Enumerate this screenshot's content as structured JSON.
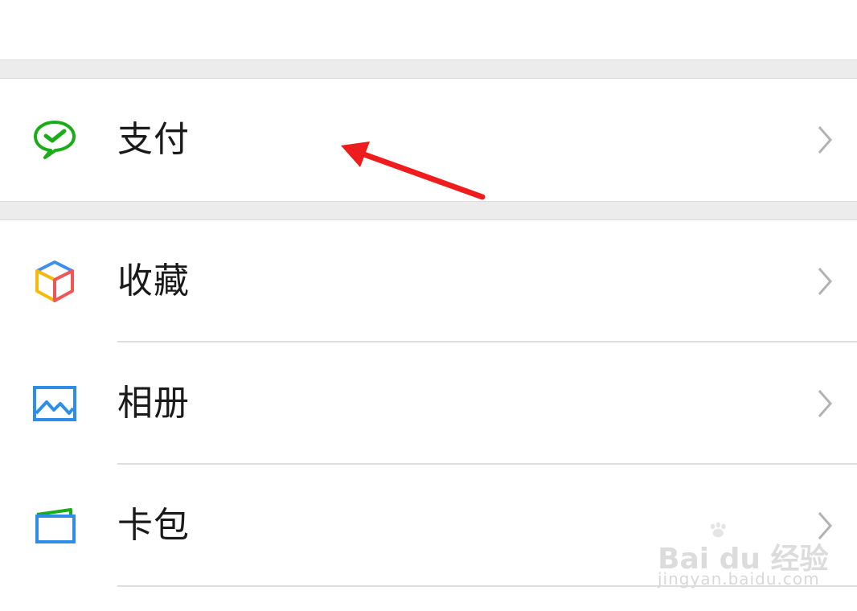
{
  "menu": {
    "items": [
      {
        "label": "支付",
        "icon": "wechat-pay-icon"
      },
      {
        "label": "收藏",
        "icon": "favorites-cube-icon"
      },
      {
        "label": "相册",
        "icon": "album-picture-icon"
      },
      {
        "label": "卡包",
        "icon": "card-wallet-icon"
      }
    ]
  },
  "annotation": {
    "color": "#ee1c1c"
  },
  "watermark": {
    "brand": "Bai du 经验",
    "url": "jingyan.baidu.com"
  },
  "colors": {
    "pay_green": "#1aad19",
    "separator": "#ececec"
  }
}
